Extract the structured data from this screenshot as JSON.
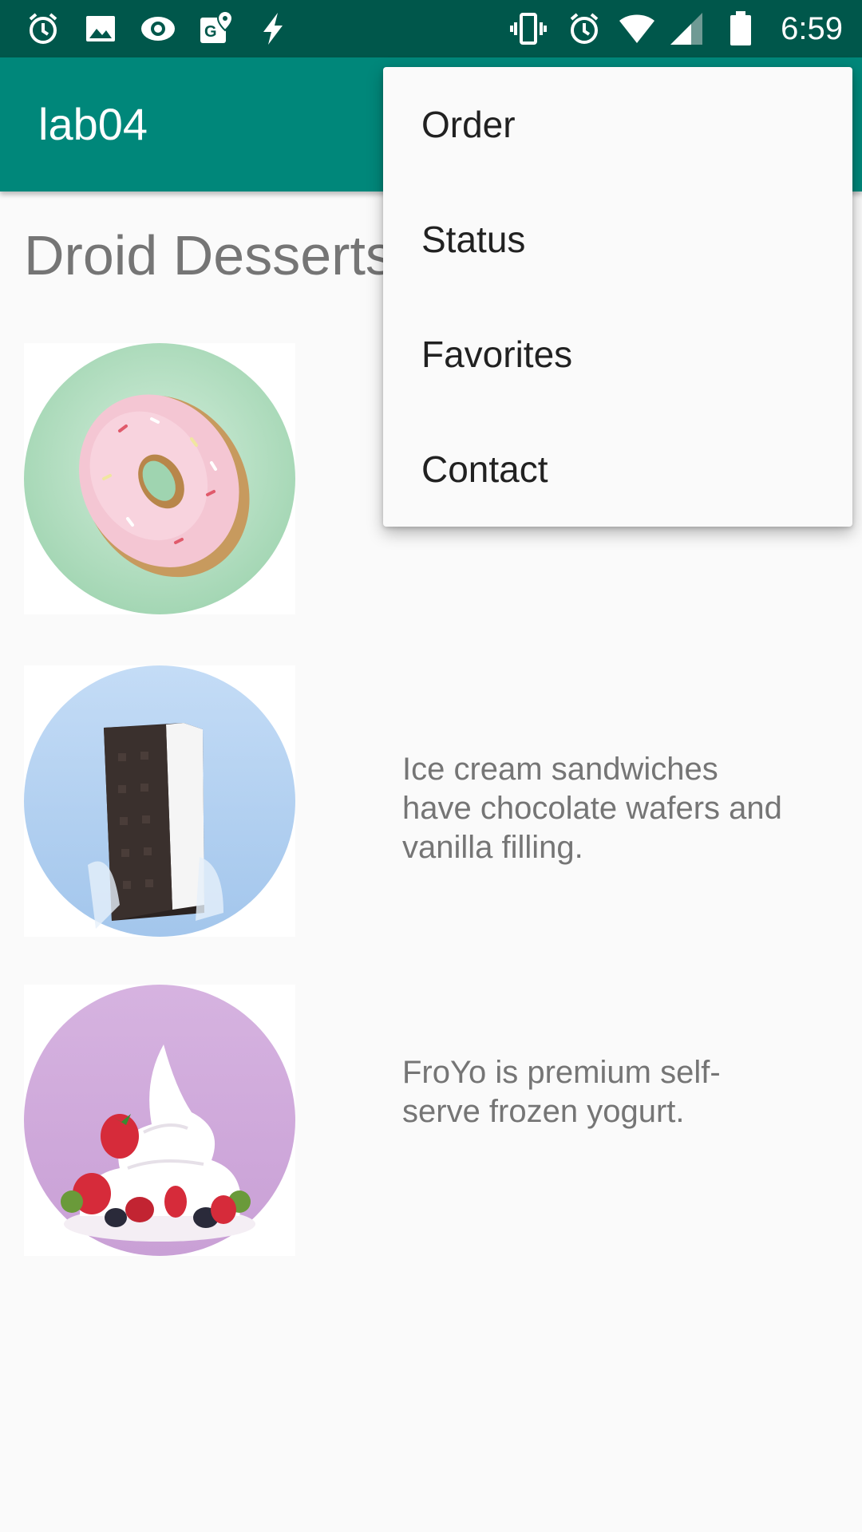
{
  "status_bar": {
    "time": "6:59",
    "left_icons": [
      "alarm-icon",
      "image-icon",
      "eye-icon",
      "maps-icon",
      "flash-icon"
    ],
    "right_icons": [
      "vibrate-icon",
      "alarm-icon",
      "wifi-icon",
      "signal-icon",
      "battery-icon"
    ]
  },
  "app_bar": {
    "title": "lab04"
  },
  "main": {
    "heading": "Droid Desserts",
    "desserts": [
      {
        "image": "donut-image",
        "description": ""
      },
      {
        "image": "ice-cream-sandwich-image",
        "description": "Ice cream sandwiches have chocolate wafers and vanilla filling."
      },
      {
        "image": "froyo-image",
        "description": "FroYo is premium self-serve frozen yogurt."
      }
    ]
  },
  "overflow_menu": {
    "items": [
      {
        "label": "Order"
      },
      {
        "label": "Status"
      },
      {
        "label": "Favorites"
      },
      {
        "label": "Contact"
      }
    ]
  },
  "colors": {
    "status_bar": "#00574b",
    "app_bar": "#00877a",
    "background": "#fafafa",
    "menu_background": "#fafafa"
  }
}
